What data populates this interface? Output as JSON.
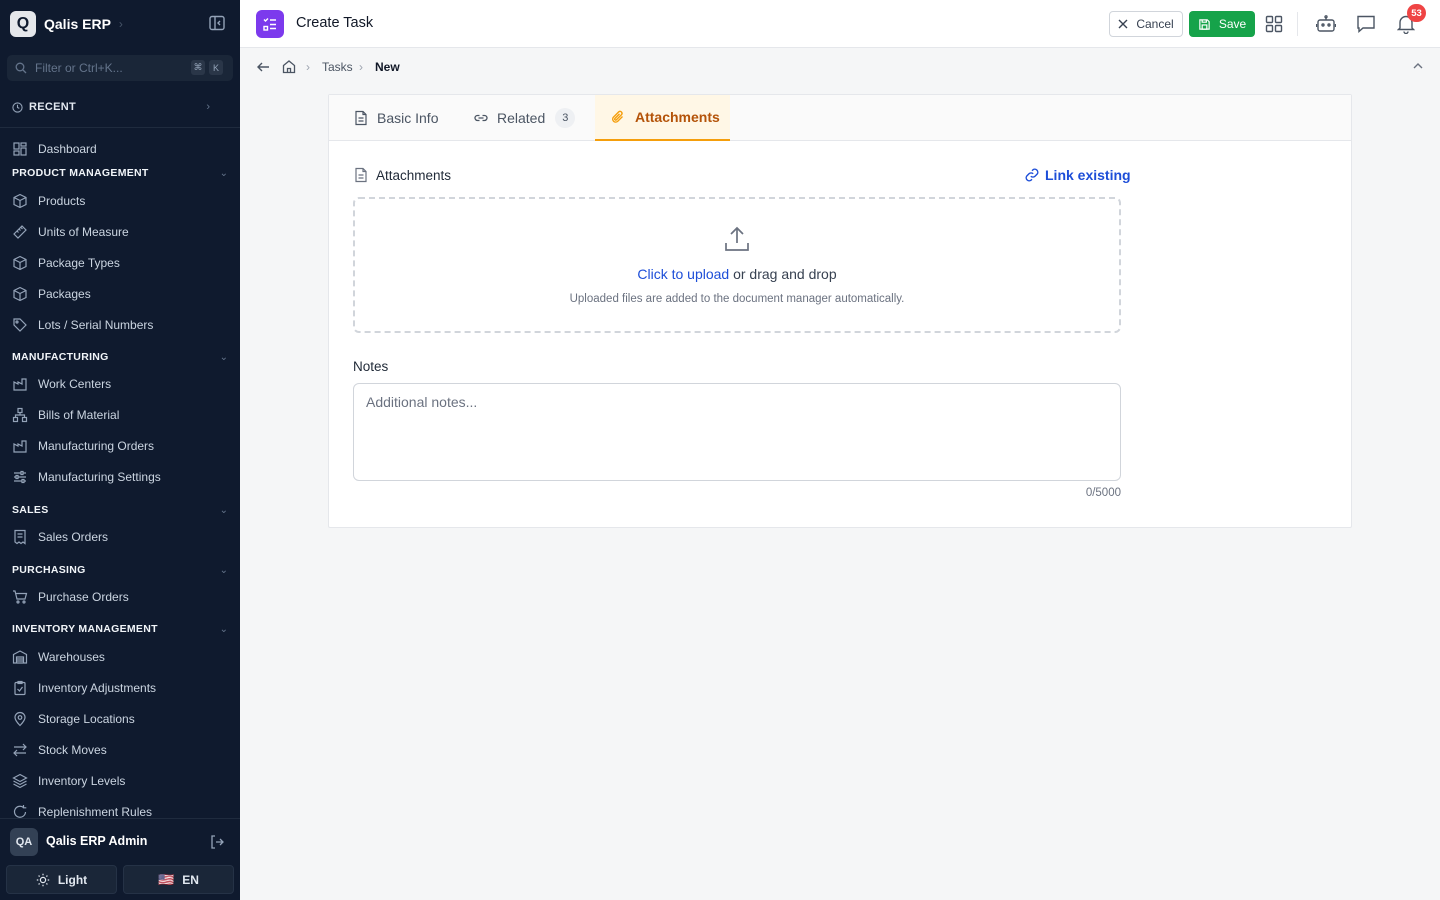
{
  "sidebar": {
    "brand": {
      "logo_letter": "Q",
      "name": "Qalis ERP"
    },
    "filter": {
      "placeholder": "Filter or Ctrl+K...",
      "keys": [
        "⌘",
        "K"
      ]
    },
    "recent_label": "RECENT",
    "dashboard_label": "Dashboard",
    "sections": [
      {
        "title": "PRODUCT MANAGEMENT",
        "items": [
          "Products",
          "Units of Measure",
          "Package Types",
          "Packages",
          "Lots / Serial Numbers"
        ]
      },
      {
        "title": "MANUFACTURING",
        "items": [
          "Work Centers",
          "Bills of Material",
          "Manufacturing Orders",
          "Manufacturing Settings"
        ]
      },
      {
        "title": "SALES",
        "items": [
          "Sales Orders"
        ]
      },
      {
        "title": "PURCHASING",
        "items": [
          "Purchase Orders"
        ]
      },
      {
        "title": "INVENTORY MANAGEMENT",
        "items": [
          "Warehouses",
          "Inventory Adjustments",
          "Storage Locations",
          "Stock Moves",
          "Inventory Levels",
          "Replenishment Rules"
        ]
      }
    ],
    "user": {
      "initials": "QA",
      "name": "Qalis ERP Admin"
    },
    "theme_label": "Light",
    "language": {
      "flag": "🇺🇸",
      "label": "EN"
    }
  },
  "header": {
    "title": "Create Task",
    "cancel_label": "Cancel",
    "save_label": "Save",
    "notification_count": "53"
  },
  "breadcrumb": {
    "items": [
      "Tasks",
      "New"
    ]
  },
  "tabs": [
    {
      "label": "Basic Info",
      "count": ""
    },
    {
      "label": "Related",
      "count": "3"
    },
    {
      "label": "Attachments",
      "count": ""
    }
  ],
  "attachments": {
    "title": "Attachments",
    "link_existing": "Link existing",
    "upload_link": "Click to upload",
    "upload_rest": " or drag and drop",
    "upload_hint": "Uploaded files are added to the document manager automatically."
  },
  "notes": {
    "label": "Notes",
    "placeholder": "Additional notes...",
    "counter": "0/5000"
  },
  "colors": {
    "sidebar_bg": "#0f1a2e",
    "accent_purple": "#7c3aed",
    "save_green": "#16a34a",
    "active_tab": "#b45309",
    "link_blue": "#1d4ed8",
    "badge_red": "#ef4444"
  }
}
